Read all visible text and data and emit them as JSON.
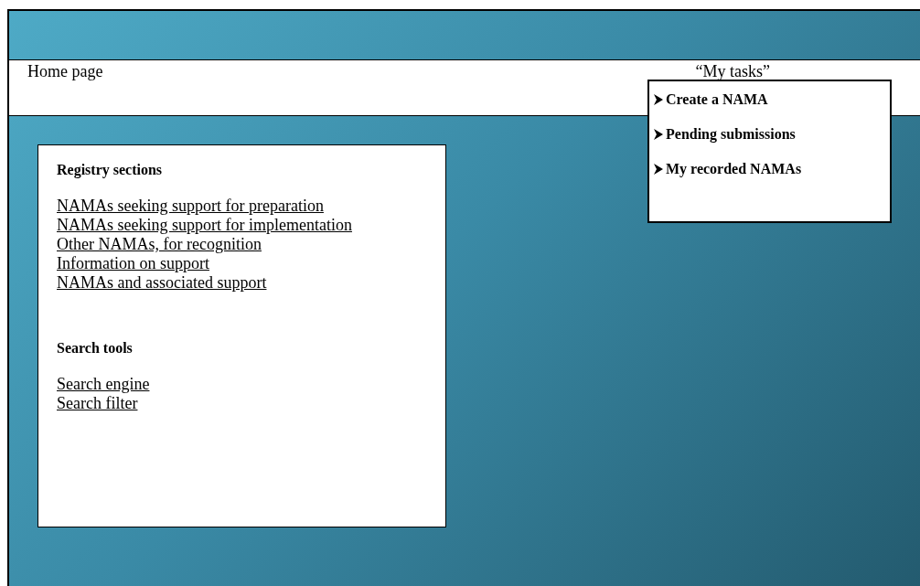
{
  "header": {
    "home_link": "Home page",
    "tasks_label": "“My tasks”"
  },
  "tasks_menu": {
    "items": [
      "Create a NAMA",
      "Pending submissions",
      "My recorded NAMAs"
    ]
  },
  "registry": {
    "title": "Registry sections",
    "links": [
      "NAMAs seeking support for preparation",
      "NAMAs seeking support for implementation",
      "Other NAMAs, for recognition",
      "Information on support",
      "NAMAs and associated support"
    ]
  },
  "search": {
    "title": "Search tools",
    "links": [
      "Search engine",
      "Search filter"
    ]
  }
}
